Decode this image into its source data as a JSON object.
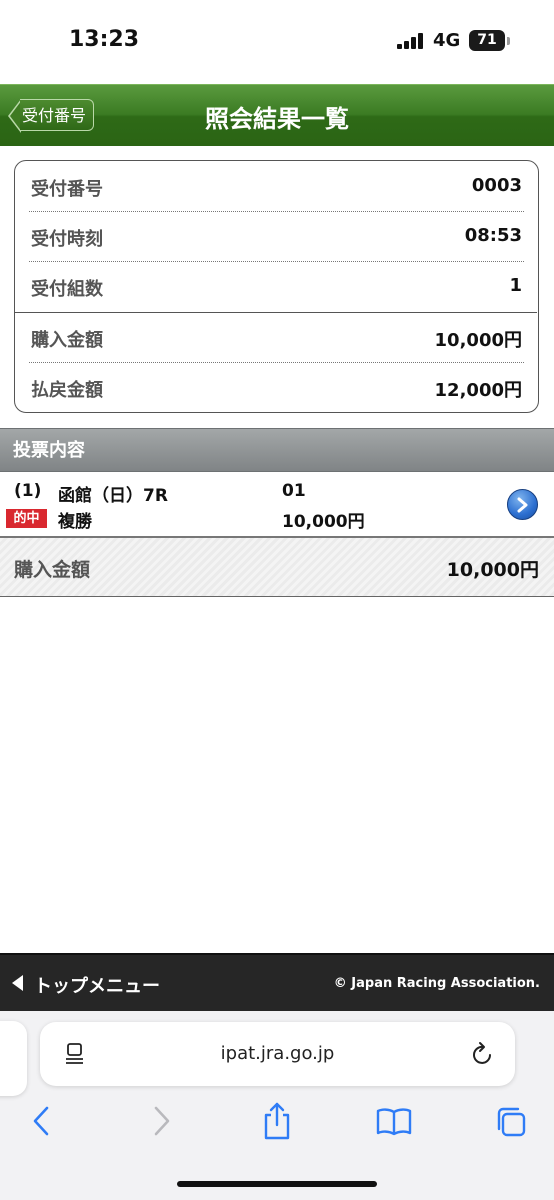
{
  "status_bar": {
    "time": "13:23",
    "network": "4G",
    "battery": "71"
  },
  "header": {
    "back_label": "受付番号",
    "title": "照会結果一覧"
  },
  "summary": {
    "rows": [
      {
        "label": "受付番号",
        "value": "0003"
      },
      {
        "label": "受付時刻",
        "value": "08:53"
      },
      {
        "label": "受付組数",
        "value": "1"
      },
      {
        "label": "購入金額",
        "value": "10,000円"
      },
      {
        "label": "払戻金額",
        "value": "12,000円"
      }
    ]
  },
  "section": {
    "title": "投票内容"
  },
  "bets": [
    {
      "number": "(1)",
      "race": "函館（日）7R",
      "horse": "01",
      "badge": "的中",
      "type": "複勝",
      "amount": "10,000円"
    }
  ],
  "total": {
    "label": "購入金額",
    "value": "10,000円"
  },
  "footer": {
    "menu_label": "トップメニュー",
    "copyright": "© Japan Racing Association."
  },
  "browser": {
    "url": "ipat.jra.go.jp"
  },
  "colors": {
    "header_green": "#3b7b23",
    "hit_red": "#d9282f",
    "footer_dark": "#262626",
    "link_blue": "#2c6fd0"
  }
}
